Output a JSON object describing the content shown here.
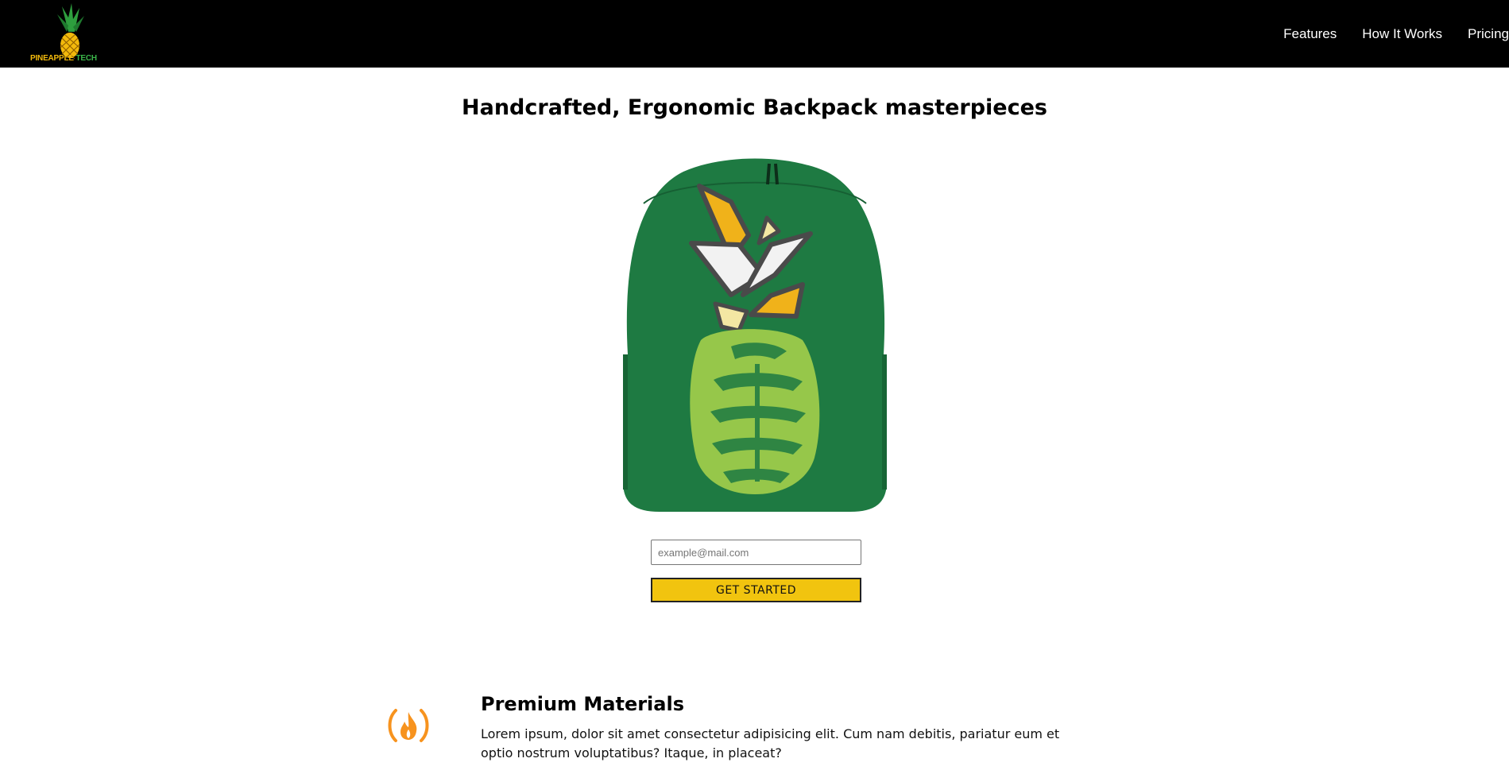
{
  "header": {
    "logo": {
      "text_brand": "PINEAPPLE",
      "text_suffix": "TECH",
      "icon": "pineapple-logo"
    },
    "nav": [
      {
        "label": "Features"
      },
      {
        "label": "How It Works"
      },
      {
        "label": "Pricing"
      }
    ]
  },
  "hero": {
    "title": "Handcrafted, Ergonomic Backpack masterpieces",
    "image": "pineapple-backpack",
    "email_placeholder": "example@mail.com",
    "cta_label": "GET STARTED"
  },
  "features": [
    {
      "icon": "fire-icon",
      "title": "Premium Materials",
      "description": "Lorem ipsum, dolor sit amet consectetur adipisicing elit. Cum nam debitis, pariatur eum et optio nostrum voluptatibus? Itaque, in placeat?"
    }
  ],
  "colors": {
    "header_bg": "#000000",
    "accent": "#f1c40f",
    "backpack_green": "#1e7a42",
    "icon_orange": "#f7931e"
  }
}
